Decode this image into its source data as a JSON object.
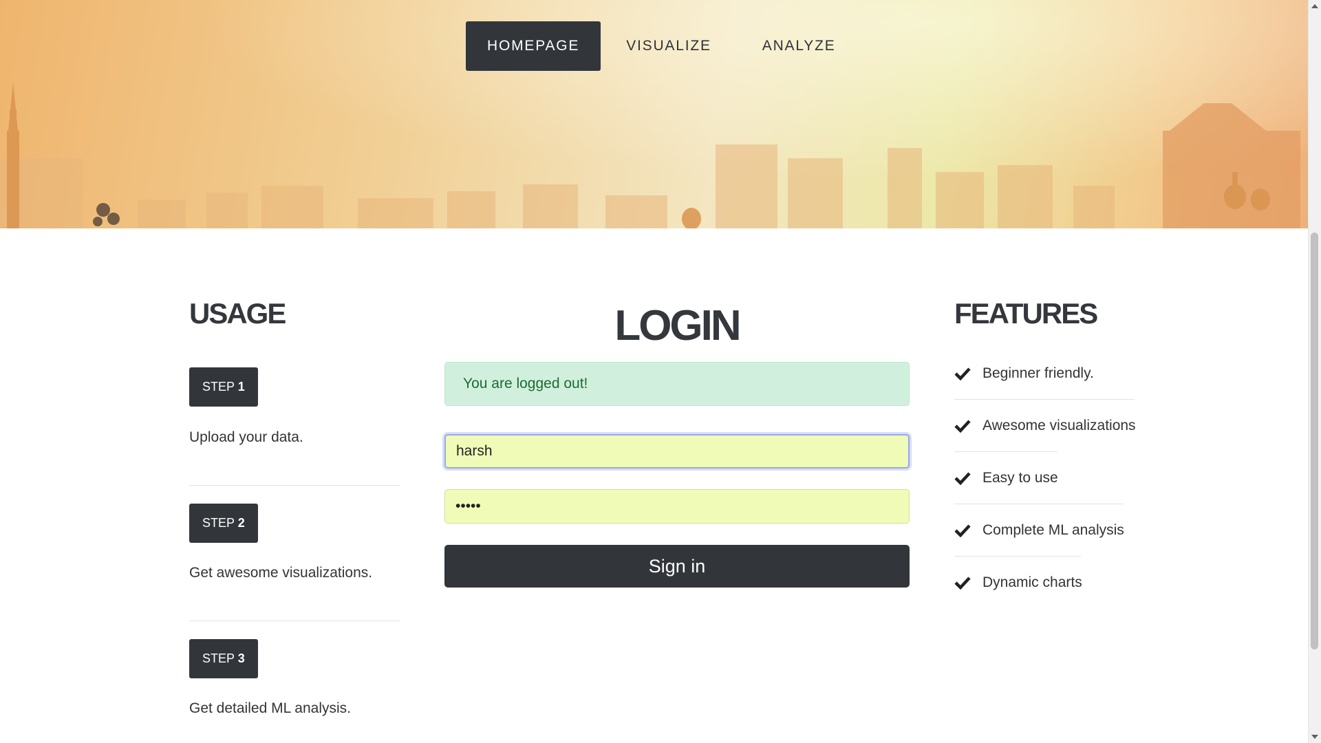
{
  "nav": {
    "items": [
      {
        "label": "HOMEPAGE",
        "active": true
      },
      {
        "label": "VISUALIZE",
        "active": false
      },
      {
        "label": "ANALYZE",
        "active": false
      }
    ]
  },
  "usage": {
    "title": "USAGE",
    "steps": [
      {
        "prefix": "STEP",
        "number": "1",
        "text": "Upload your data."
      },
      {
        "prefix": "STEP",
        "number": "2",
        "text": "Get awesome visualizations."
      },
      {
        "prefix": "STEP",
        "number": "3",
        "text": "Get detailed ML analysis."
      }
    ]
  },
  "login": {
    "title": "LOGIN",
    "alert": "You are logged out!",
    "username_value": "harsh",
    "password_value": "•••••",
    "submit_label": "Sign in"
  },
  "features": {
    "title": "FEATURES",
    "items": [
      "Beginner friendly.",
      "Awesome visualizations",
      "Easy to use",
      "Complete ML analysis",
      "Dynamic charts"
    ]
  },
  "colors": {
    "dark": "#32363b",
    "alert_bg": "#d0f0dd",
    "alert_text": "#1c6b32",
    "field_bg": "#f0fbb7"
  }
}
